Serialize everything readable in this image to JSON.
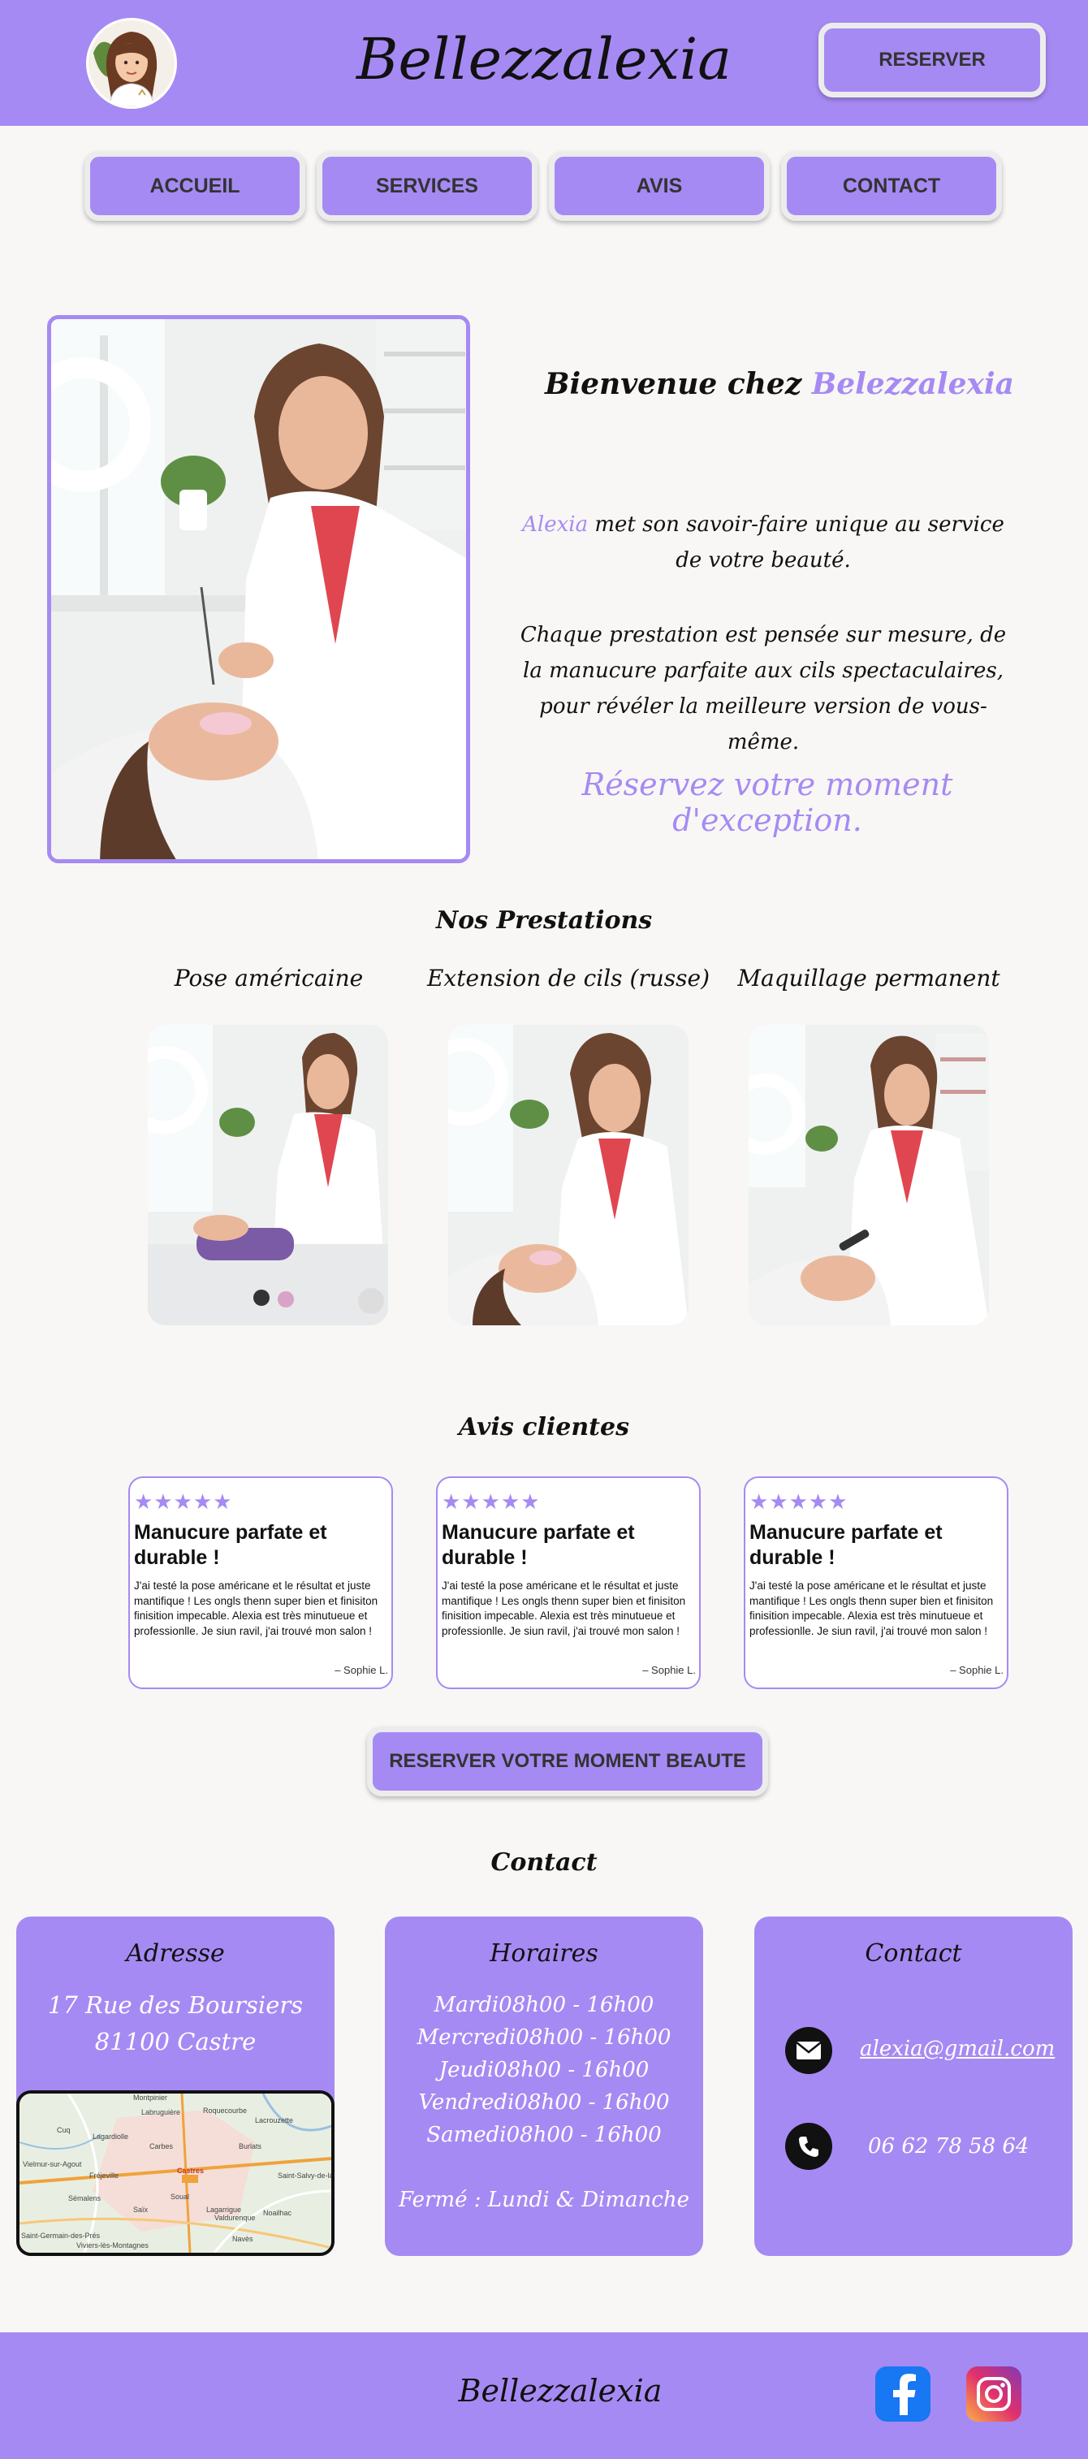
{
  "header": {
    "brand": "Bellezzalexia",
    "reserve_label": "RESERVER"
  },
  "nav": {
    "items": [
      {
        "label": "ACCUEIL"
      },
      {
        "label": "SERVICES"
      },
      {
        "label": "AVIS"
      },
      {
        "label": "CONTACT"
      }
    ]
  },
  "hero": {
    "title_prefix": "Bienvenue chez ",
    "title_brand": "Belezzalexia",
    "p1_name": "Alexia",
    "p1_rest": " met son savoir-faire unique au service de votre beauté.",
    "p2": "Chaque prestation est pensée sur mesure, de la manucure parfaite aux cils spectaculaires, pour révéler la meilleure version de vous-même.",
    "cta": "Réservez votre moment d'exception."
  },
  "services": {
    "title": "Nos Prestations",
    "items": [
      {
        "name": "Pose américaine"
      },
      {
        "name": "Extension de cils (russe)"
      },
      {
        "name": "Maquillage permanent"
      }
    ]
  },
  "reviews": {
    "title": "Avis clientes",
    "items": [
      {
        "stars": "★★★★★",
        "title": "Manucure parfate et durable !",
        "text": "J'ai testé la pose américane et le résultat et juste mantifique ! Les ongls thenn super bien et finisiton finisition impecable. Alexia est très minutueue et professionlle. Je siun ravil, j'ai trouvé mon salon !",
        "author": "– Sophie L."
      },
      {
        "stars": "★★★★★",
        "title": "Manucure parfate et durable !",
        "text": "J'ai testé la pose américane et le résultat et juste mantifique ! Les ongls thenn super bien et finisiton finisition impecable. Alexia est très minutueue et professionlle. Je siun ravil, j'ai trouvé mon salon !",
        "author": "– Sophie L."
      },
      {
        "stars": "★★★★★",
        "title": "Manucure parfate et durable !",
        "text": "J'ai testé la pose américane et le résultat et juste mantifique ! Les ongls thenn super bien et finisiton finisition impecable. Alexia est très minutueue et professionlle. Je siun ravil, j'ai trouvé mon salon !",
        "author": "– Sophie L."
      }
    ],
    "cta_label": "RESERVER VOTRE MOMENT BEAUTE"
  },
  "contact": {
    "title": "Contact",
    "address": {
      "title": "Adresse",
      "line1": "17 Rue des Boursiers",
      "line2": "81100 Castre",
      "map_labels": [
        "Montpinier",
        "Labruguière",
        "Roquecourbe",
        "Lacrouzette",
        "Cuq",
        "Lagardiolle",
        "Burlats",
        "Castres",
        "Viviers-lès-Montagnes",
        "Saïx",
        "Navès",
        "Noailhac",
        "Valdurenque",
        "Lagarrigue",
        "Sémalens",
        "Vielmur-sur-Agout",
        "Fréjeville",
        "Soual",
        "Saint-Germain-des-Prés",
        "Carbes",
        "Saint-Salvy-de-la-Balme"
      ]
    },
    "hours": {
      "title": "Horaires",
      "lines": [
        "Mardi08h00 - 16h00",
        "Mercredi08h00 - 16h00",
        "Jeudi08h00 - 16h00",
        "Vendredi08h00 - 16h00",
        "Samedi08h00 - 16h00"
      ],
      "closed": "Fermé : Lundi & Dimanche"
    },
    "card": {
      "title": "Contact",
      "email": "alexia@gmail.com",
      "phone": "06 62 78 58 64",
      "email_icon": "envelope-icon",
      "phone_icon": "phone-icon"
    }
  },
  "footer": {
    "brand": "Bellezzalexia",
    "social": [
      {
        "icon": "facebook-icon",
        "color": "#1877f2"
      },
      {
        "icon": "instagram-icon",
        "color": "#e1306c"
      }
    ]
  },
  "colors": {
    "accent": "#a68af3",
    "background": "#f8f7f5"
  }
}
